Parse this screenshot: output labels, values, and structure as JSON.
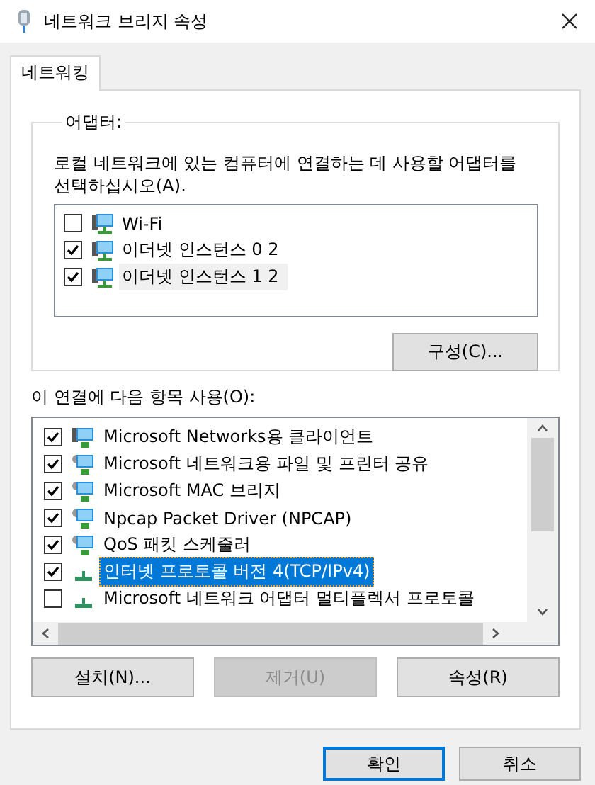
{
  "window": {
    "title": "네트워크 브리지 속성"
  },
  "tabs": [
    {
      "label": "네트워킹",
      "selected": true
    }
  ],
  "adapters": {
    "title": "어댑터:",
    "description": "로컬 네트워크에 있는 컴퓨터에 연결하는 데 사용할 어댑터를 선택하십시오(A).",
    "items": [
      {
        "label": "Wi-Fi",
        "checked": false,
        "selected": false
      },
      {
        "label": "이더넷 인스턴스 0 2",
        "checked": true,
        "selected": false
      },
      {
        "label": "이더넷 인스턴스 1 2",
        "checked": true,
        "selected": true
      }
    ],
    "button": "구성(C)..."
  },
  "components": {
    "label": "이 연결에 다음 항목 사용(O):",
    "items": [
      {
        "label": "Microsoft Networks용 클라이언트",
        "checked": true,
        "selected": false,
        "kind": "client"
      },
      {
        "label": "Microsoft 네트워크용 파일 및 프린터 공유",
        "checked": true,
        "selected": false,
        "kind": "service"
      },
      {
        "label": "Microsoft MAC 브리지",
        "checked": true,
        "selected": false,
        "kind": "service"
      },
      {
        "label": "Npcap Packet Driver (NPCAP)",
        "checked": true,
        "selected": false,
        "kind": "service"
      },
      {
        "label": "QoS 패킷 스케줄러",
        "checked": true,
        "selected": false,
        "kind": "service"
      },
      {
        "label": "인터넷 프로토콜 버전 4(TCP/IPv4)",
        "checked": true,
        "selected": true,
        "kind": "protocol"
      },
      {
        "label": "Microsoft 네트워크 어댑터 멀티플렉서 프로토콜",
        "checked": false,
        "selected": false,
        "kind": "protocol"
      }
    ],
    "buttons": [
      {
        "label": "설치(N)...",
        "disabled": false
      },
      {
        "label": "제거(U)",
        "disabled": true
      },
      {
        "label": "속성(R)",
        "disabled": false
      }
    ]
  },
  "footer_buttons": [
    {
      "label": "확인",
      "default": true
    },
    {
      "label": "취소",
      "default": false
    }
  ]
}
